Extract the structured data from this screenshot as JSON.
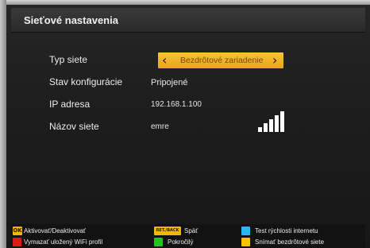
{
  "header": {
    "title": "Sieťové nastavenia"
  },
  "settings": {
    "network_type": {
      "label": "Typ siete",
      "value": "Bezdrôtové zariadenie",
      "prev_icon": "‹",
      "next_icon": "›"
    },
    "config_state": {
      "label": "Stav konfigurácie",
      "value": "Pripojené"
    },
    "ip_address": {
      "label": "IP adresa",
      "value": "192.168.1.100"
    },
    "network_name": {
      "label": "Názov siete",
      "value": "emre",
      "signal_icon": "wifi-signal-strength-icon"
    }
  },
  "footer": {
    "items": [
      {
        "key": "OK",
        "label": "Aktivovať/Deaktivovať",
        "key_color": "#f2b800"
      },
      {
        "key": "RET./BACK",
        "label": "Späť",
        "key_color": "#f2b800"
      },
      {
        "key": "",
        "label": "Test rýchlosti internetu",
        "key_color": "#28b8f0"
      },
      {
        "key": "",
        "label": "Vymazať uložený WiFi profil",
        "key_color": "#e01818"
      },
      {
        "key": "",
        "label": "Pokročilý",
        "key_color": "#22c41e"
      },
      {
        "key": "",
        "label": "Snímať bezdrôtové siete",
        "key_color": "#f2c400"
      }
    ]
  },
  "colors": {
    "selector": "#f2b120",
    "background": "#1e1e1e"
  }
}
